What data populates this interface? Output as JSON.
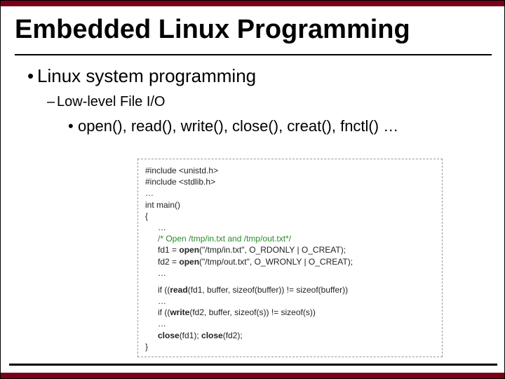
{
  "title": "Embedded Linux Programming",
  "bullets": {
    "lvl1": "Linux system programming",
    "lvl2": "Low-level File I/O",
    "lvl3": "open(), read(), write(), close(), creat(), fnctl() …"
  },
  "code": {
    "inc1": "#include <unistd.h>",
    "inc2": "#include <stdlib.h>",
    "dots1": "…",
    "main": "int main()",
    "lb": "{",
    "dots2": "…",
    "comment": "/* Open /tmp/in.txt and /tmp/out.txt*/",
    "fd1a": "fd1 = ",
    "open1": "open",
    "fd1b": "(\"/tmp/in.txt\", O_RDONLY | O_CREAT);",
    "fd2a": "fd2 = ",
    "open2": "open",
    "fd2b": "(\"/tmp/out.txt\", O_WRONLY | O_CREAT);",
    "dots3": "…",
    "if1a": "if ((",
    "read": "read",
    "if1b": "(fd1, buffer, sizeof(buffer)) != sizeof(buffer))",
    "dots4": "…",
    "if2a": "if ((",
    "write": "write",
    "if2b": "(fd2, buffer, sizeof(s)) != sizeof(s))",
    "dots5": "…",
    "close1": "close",
    "cl1": "(fd1); ",
    "close2": "close",
    "cl2": "(fd2);",
    "rb": "}"
  }
}
